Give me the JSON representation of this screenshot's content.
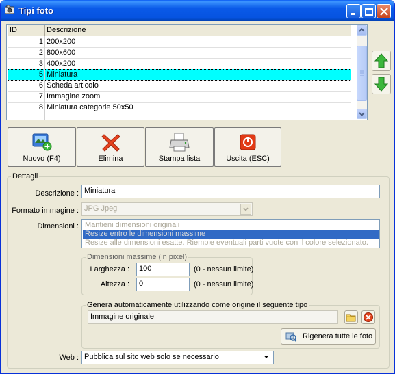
{
  "window": {
    "title": "Tipi foto"
  },
  "grid": {
    "columns": [
      "ID",
      "Descrizione"
    ],
    "rows": [
      {
        "id": "1",
        "desc": "200x200"
      },
      {
        "id": "2",
        "desc": "800x600"
      },
      {
        "id": "3",
        "desc": "400x200"
      },
      {
        "id": "5",
        "desc": "Miniatura"
      },
      {
        "id": "6",
        "desc": "Scheda articolo"
      },
      {
        "id": "7",
        "desc": "Immagine zoom"
      },
      {
        "id": "8",
        "desc": "Miniatura categorie 50x50"
      }
    ],
    "selected_id": "5"
  },
  "toolbar": {
    "new_label": "Nuovo (F4)",
    "delete_label": "Elimina",
    "print_label": "Stampa lista",
    "exit_label": "Uscita (ESC)"
  },
  "details": {
    "group_label": "Dettagli",
    "descrizione_label": "Descrizione :",
    "descrizione_value": "Miniatura",
    "formato_label": "Formato immagine :",
    "formato_value": "JPG Jpeg",
    "dimensioni_label": "Dimensioni :",
    "dimensioni_options": [
      "Mantieni dimensioni originali",
      "Resize entro le dimensioni massime",
      "Resize alle dimensioni esatte. Riempie eventuali parti vuote con il colore selezionato."
    ],
    "dimensioni_selected": "Resize entro le dimensioni massime",
    "max_group_label": "Dimensioni massime (in pixel)",
    "larghezza_label": "Larghezza :",
    "larghezza_value": "100",
    "larghezza_hint": "(0 - nessun limite)",
    "altezza_label": "Altezza :",
    "altezza_value": "0",
    "altezza_hint": "(0 - nessun limite)",
    "genera_group_label": "Genera automaticamente utilizzando come origine il seguente tipo",
    "origine_value": "Immagine originale",
    "rigenera_label": "Rigenera tutte le foto",
    "web_label": "Web :",
    "web_value": "Pubblica sul sito web solo se necessario"
  },
  "icons": {
    "app": "camera-icon",
    "minimize": "minimize-icon",
    "maximize": "maximize-icon",
    "close": "close-icon",
    "move_up": "arrow-up-icon",
    "move_down": "arrow-down-icon",
    "new": "new-photo-icon",
    "delete": "delete-x-icon",
    "print": "printer-icon",
    "exit": "exit-icon",
    "browse": "folder-icon",
    "clear": "clear-icon",
    "regenerate": "regenerate-icon"
  },
  "colors": {
    "titlebar": "#0a5ae8",
    "selected_row": "#00ffff",
    "list_selection": "#316ac5",
    "window_bg": "#ece9d8"
  }
}
